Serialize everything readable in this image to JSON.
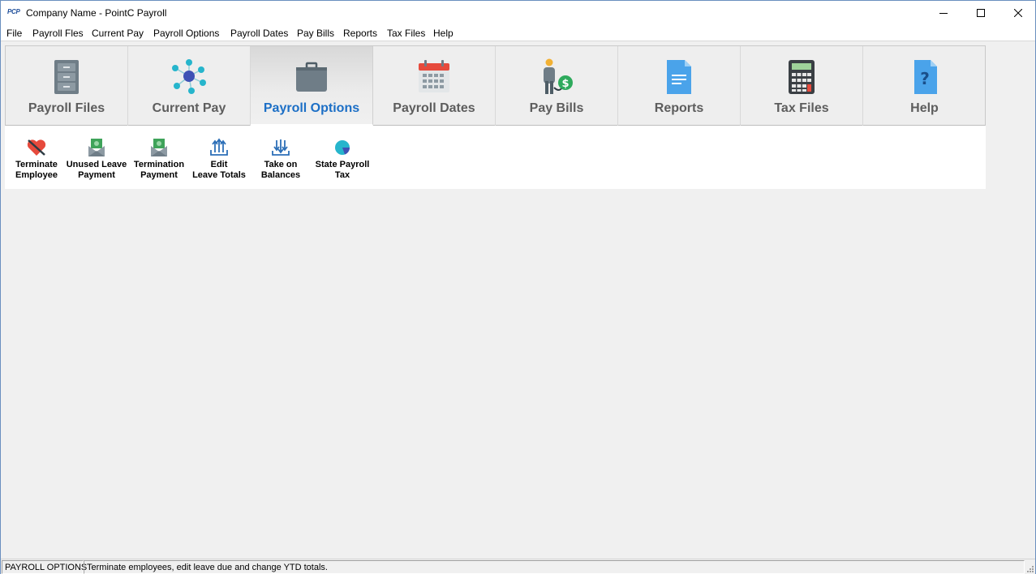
{
  "window": {
    "logo_text": "PCP",
    "title": "Company Name - PointC Payroll"
  },
  "menu": [
    "File",
    "Payroll Fles",
    "Current Pay",
    "Payroll Options",
    "Payroll Dates",
    "Pay Bills",
    "Reports",
    "Tax Files",
    "Help"
  ],
  "tabs": [
    {
      "label": "Payroll Files",
      "icon": "filing-cabinet-icon"
    },
    {
      "label": "Current Pay",
      "icon": "network-icon"
    },
    {
      "label": "Payroll Options",
      "icon": "briefcase-icon",
      "active": true
    },
    {
      "label": "Payroll Dates",
      "icon": "calendar-icon"
    },
    {
      "label": "Pay Bills",
      "icon": "person-dollar-icon"
    },
    {
      "label": "Reports",
      "icon": "document-icon"
    },
    {
      "label": "Tax Files",
      "icon": "calculator-icon"
    },
    {
      "label": "Help",
      "icon": "help-document-icon"
    }
  ],
  "tools": [
    {
      "line1": "Terminate",
      "line2": "Employee",
      "icon": "broken-heart-icon"
    },
    {
      "line1": "Unused Leave",
      "line2": "Payment",
      "icon": "money-envelope-icon"
    },
    {
      "line1": "Termination",
      "line2": "Payment",
      "icon": "money-envelope-icon"
    },
    {
      "line1": "Edit",
      "line2": "Leave Totals",
      "icon": "arrows-up-tray-icon"
    },
    {
      "line1": "Take on",
      "line2": "Balances",
      "icon": "arrows-down-tray-icon"
    },
    {
      "line1": "State Payroll",
      "line2": "Tax",
      "icon": "pie-chart-icon"
    }
  ],
  "status": {
    "section": "PAYROLL OPTIONS",
    "message": "Terminate employees, edit leave due and change YTD totals."
  },
  "colors": {
    "active_tab_text": "#1c6fc6",
    "tab_text": "#5d5d5d",
    "accent_teal": "#26b5cc",
    "icon_gray": "#6f7d87"
  }
}
